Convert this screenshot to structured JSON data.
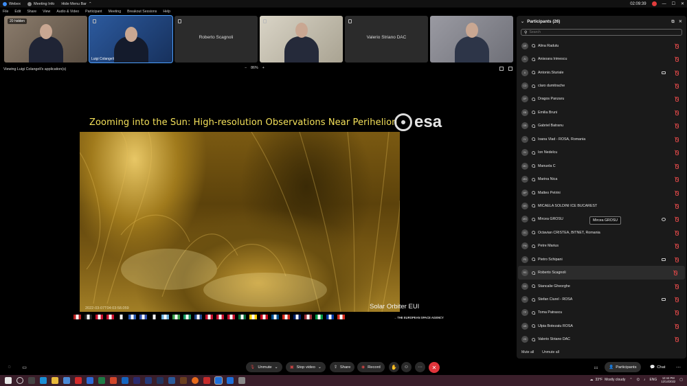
{
  "titlebar": {
    "app": "Webex",
    "meeting_info": "Meeting Info",
    "hide_menu": "Hide Menu Bar",
    "time": "02:09:39"
  },
  "menu": [
    "File",
    "Edit",
    "Share",
    "View",
    "Audio & Video",
    "Participant",
    "Meeting",
    "Breakout Sessions",
    "Help"
  ],
  "thumbnails": {
    "hidden_badge": "20 hidden",
    "tile2_name": "Luigi Colangeli",
    "tile3_name": "Roberto Scagnoli",
    "tile5_name": "Valerio Striano DAC"
  },
  "viewbar": {
    "label": "Viewing Luigi Colangeli's application(s)",
    "zoom_minus": "−",
    "zoom": "86%",
    "zoom_plus": "+"
  },
  "slide": {
    "title": "Zooming into the Sun: High-resolution Observations Near Perihelion",
    "logo_text": "esa",
    "stamp": "2022-03-07T04:03:58.059",
    "caption": "Solar Orbiter EUI",
    "agency": "→ THE EUROPEAN SPACE AGENCY",
    "flag_colors": [
      "#b22",
      "#222",
      "#c8102e",
      "#c8102e",
      "#000",
      "#2a5ab3",
      "#3050b0",
      "#000",
      "#6bb2e0",
      "#3aa04a",
      "#169b62",
      "#21468b",
      "#c8102e",
      "#c8102e",
      "#c8102e",
      "#046a38",
      "#ffcd00",
      "#c60b1e",
      "#005293",
      "#d52b1e",
      "#012169",
      "#9e3039",
      "#009a44",
      "#0039a6",
      "#d52b1e"
    ]
  },
  "panel": {
    "title": "Participants (26)",
    "search_placeholder": "Search",
    "mute_all": "Mute all",
    "unmute_all": "Unmute all",
    "tooltip": "Mircea GROSU"
  },
  "participants": [
    {
      "initials": "AR",
      "name": "Alina Radutu"
    },
    {
      "initials": "AI",
      "name": "Anisoara Irimescu"
    },
    {
      "initials": "A",
      "name": "Antonio.Sturiale"
    },
    {
      "initials": "CD",
      "name": "claro dumitrache"
    },
    {
      "initials": "DP",
      "name": "Dragos Panzaru"
    },
    {
      "initials": "EB",
      "name": "Emilia Bruni"
    },
    {
      "initials": "GB",
      "name": "Gabriel Batranu"
    },
    {
      "initials": "IV",
      "name": "Ioana Vlad - ROSA, Romania"
    },
    {
      "initials": "IN",
      "name": "Ion Nedelcu"
    },
    {
      "initials": "MC",
      "name": "Manuela C"
    },
    {
      "initials": "MN",
      "name": "Marina Nica"
    },
    {
      "initials": "MP",
      "name": "Matteo Petrini"
    },
    {
      "initials": "MS",
      "name": "MICAELA SOLDINI ICE BUCAREST"
    },
    {
      "initials": "MG",
      "name": "Mircea GROSU"
    },
    {
      "initials": "OC",
      "name": "Octavian CRISTEA, BITNET, Romania"
    },
    {
      "initials": "PM",
      "name": "Petre Marius"
    },
    {
      "initials": "PS",
      "name": "Pietro Schipani"
    },
    {
      "initials": "RS",
      "name": "Roberto Scagnoli"
    },
    {
      "initials": "SG",
      "name": "Stancalie Gheorghe"
    },
    {
      "initials": "SC",
      "name": "Stefan Ciurel - ROSA"
    },
    {
      "initials": "TP",
      "name": "Toma Patrascu"
    },
    {
      "initials": "UB",
      "name": "Ulpia Botezatu ROSA"
    },
    {
      "initials": "VD",
      "name": "Valerio Striano DAC"
    }
  ],
  "controls": {
    "unmute": "Unmute",
    "stop_video": "Stop video",
    "share": "Share",
    "record": "Record",
    "more": "···",
    "participants_tab": "Participants",
    "chat_tab": "Chat"
  },
  "taskbar": {
    "temperature": "33°F",
    "weather": "Mostly cloudy",
    "lang": "ENG",
    "time": "12:44 PM",
    "date": "12/14/2022"
  }
}
